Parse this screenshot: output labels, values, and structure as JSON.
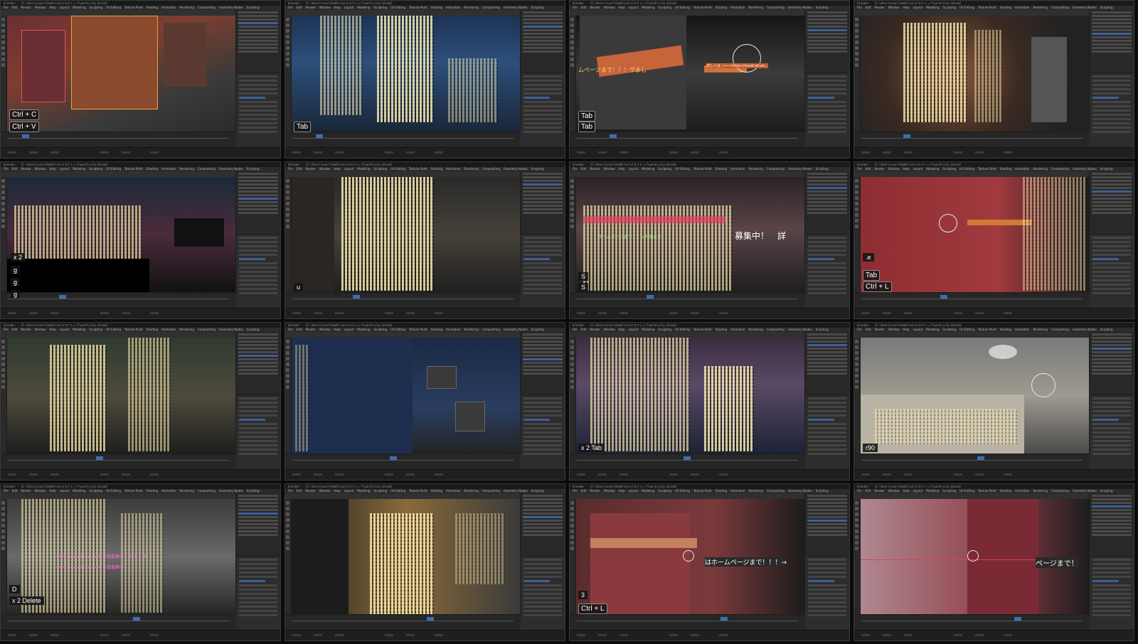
{
  "window_title": "blender - [C:\\Users\\user\\OneDrive\\デスクトップ\\work\\city.blend]",
  "menu_items": [
    "File",
    "Edit",
    "Render",
    "Window",
    "Help",
    "Layout",
    "Modeling",
    "Sculpting",
    "UV Editing",
    "Texture Paint",
    "Shading",
    "Animation",
    "Rendering",
    "Compositing",
    "Geometry Nodes",
    "Scripting"
  ],
  "overlays": {
    "t1_ctrl_c": "Ctrl + C",
    "t1_ctrl_v": "Ctrl + V",
    "t2_tab": "Tab",
    "t3_tab1": "Tab",
    "t3_tab2": "Tab",
    "t3_sign_text": "ムページまで！！！ヴまし",
    "t3_url_text": "詳しくは →→→ https://novel.drum...",
    "t5_x2": "x 2",
    "t5_g1": "g",
    "t5_g2": "g",
    "t5_g3": "g",
    "t6_u": "u",
    "t7_recruit": "募集中！　詳",
    "t7_sign": "ホームページまで！！→ https://",
    "t7_s1": "S",
    "t7_s2": "S",
    "t8_e": ".e",
    "t8_tab": "Tab",
    "t8_ctrl_l": "Ctrl + L",
    "t11_x2tab": "x 2 Tab",
    "t12_r90": "r90",
    "t13_d": "D",
    "t13_x2delete": "x 2 Delete",
    "t13_neon1": "www.noveldrum.com 社員募集中！ 詳しくは",
    "t13_neon2": "www.noveldrum.com 社員募集中！",
    "t15_sign": "はホームページまで！！！→",
    "t15_ctrl_l": "Ctrl + L",
    "t15_num": "3",
    "t16_sign": "ページまで！"
  }
}
